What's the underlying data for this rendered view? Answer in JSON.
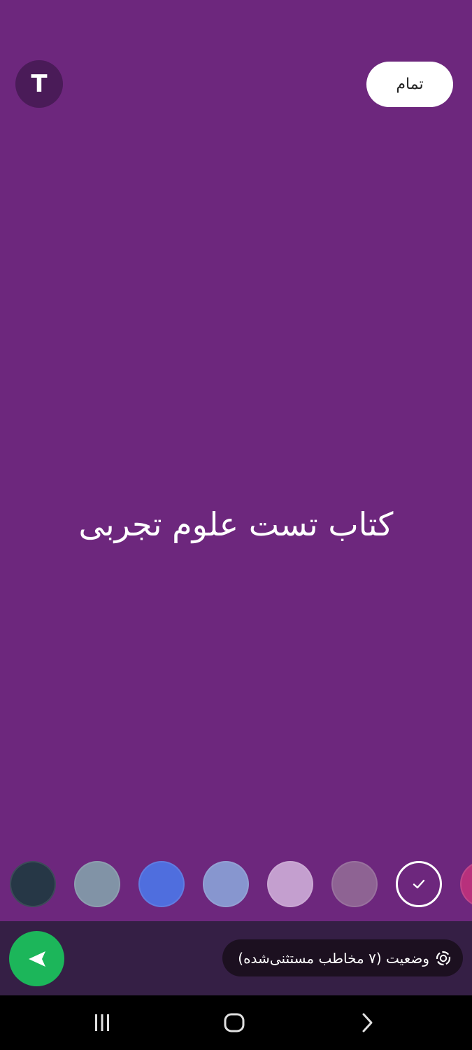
{
  "colors": {
    "canvas_bg": "#6d277d",
    "font_toggle_bg": "#4a1b58",
    "accent_green": "#1cb65a"
  },
  "font_toggle": {
    "label": "T"
  },
  "done_button": {
    "label": "تمام"
  },
  "status": {
    "text": "کتاب تست علوم تجربی"
  },
  "color_palette": [
    {
      "color": "#263746",
      "selected": false
    },
    {
      "color": "#8193a6",
      "selected": false
    },
    {
      "color": "#4f6ede",
      "selected": false
    },
    {
      "color": "#8796cf",
      "selected": false
    },
    {
      "color": "#c49fcf",
      "selected": false
    },
    {
      "color": "#8e6393",
      "selected": false
    },
    {
      "color": "#6d277d",
      "selected": true,
      "icon": "check-icon"
    },
    {
      "color": "#b8307c",
      "selected": false
    }
  ],
  "bottom_bar": {
    "audience_label": "وضعیت (۷ مخاطب مستثنی‌شده)",
    "audience_icon": "status-ring-icon",
    "send_icon": "send-arrow-icon"
  },
  "nav_bar": {
    "icons": [
      "recent-apps-icon",
      "home-icon",
      "back-icon"
    ]
  }
}
